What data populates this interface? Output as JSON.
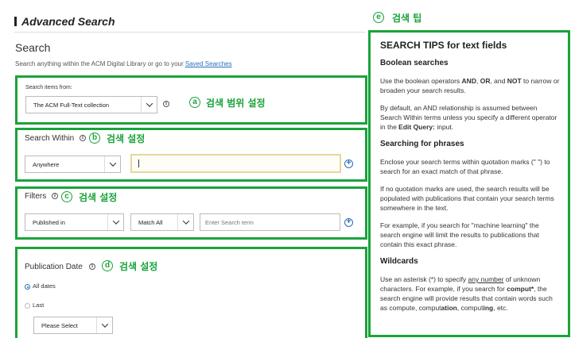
{
  "header": {
    "title": "Advanced Search"
  },
  "search": {
    "heading": "Search",
    "intro_text": "Search anything within the ACM Digital Library or go to your ",
    "saved_link": "Saved Searches"
  },
  "scope": {
    "label": "Search items from:",
    "selected": "The ACM Full-Text collection"
  },
  "within": {
    "label": "Search Within",
    "field_selected": "Anywhere",
    "query_value": ""
  },
  "filters": {
    "label": "Filters",
    "field_selected": "Published in",
    "match_selected": "Match All",
    "placeholder": "Enter Search term"
  },
  "pubdate": {
    "label": "Publication Date",
    "opt_all": "All dates",
    "opt_last": "Last",
    "last_select": "Please Select"
  },
  "annotations": {
    "a_letter": "a",
    "a_text": "검색 범위 설정",
    "b_letter": "b",
    "b_text": "검색 설정",
    "c_letter": "c",
    "c_text": "검색 설정",
    "d_letter": "d",
    "d_text": "검색 설정",
    "e_letter": "e",
    "e_text": "검색 팁"
  },
  "tips": {
    "title": "SEARCH TIPS for text fields",
    "boolean_heading": "Boolean searches",
    "boolean_p1_a": "Use the boolean operators ",
    "op_and": "AND",
    "sep1": ", ",
    "op_or": "OR",
    "sep2": ", and ",
    "op_not": "NOT",
    "boolean_p1_b": " to narrow or broaden your search results.",
    "boolean_p2_a": "By default, an AND relationship is assumed between Search Within terms unless you specify a different operator in the ",
    "edit_query": "Edit Query:",
    "boolean_p2_b": " input.",
    "phrases_heading": "Searching for phrases",
    "phrases_p1": "Enclose your search terms within quotation marks (\" \") to search for an exact match of that phrase.",
    "phrases_p2": "If no quotation marks are used, the search results will be populated with publications that contain your search terms somewhere in the text.",
    "phrases_p3": "For example, if you search for \"machine learning\" the search engine will limit the results to publications that contain this exact phrase.",
    "wildcards_heading": "Wildcards",
    "wild_p_a": "Use an asterisk (*) to specify ",
    "any_number": "any number",
    "wild_p_b": " of unknown characters. For example, if you search for ",
    "comput": "comput*",
    "wild_p_c": ", the search engine will provide results that contain words such as compute, comput",
    "ation": "ation",
    "wild_p_d": ", comput",
    "ing": "ing",
    "wild_p_e": ", etc."
  },
  "colors": {
    "annotation_green": "#1aa33a",
    "link_blue": "#2a6ebb",
    "input_focus": "#e6d79a"
  }
}
